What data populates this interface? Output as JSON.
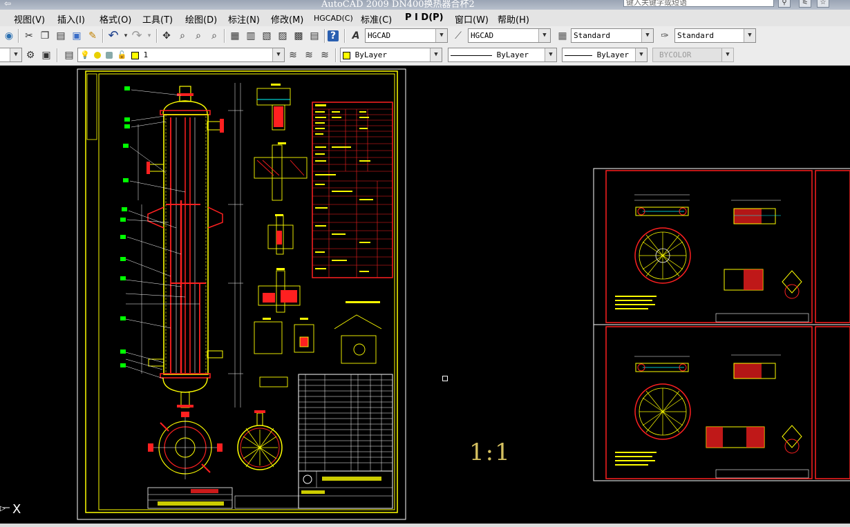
{
  "window": {
    "title": "AutoCAD 2009  DN400换热器合杯2",
    "search_placeholder": "键入关键字或短语"
  },
  "menu": {
    "items": [
      "视图(V)",
      "插入(I)",
      "格式(O)",
      "工具(T)",
      "绘图(D)",
      "标注(N)",
      "修改(M)",
      "HGCAD(C)",
      "标准(C)",
      "P I D(P)",
      "窗口(W)",
      "帮助(H)"
    ]
  },
  "toolbar1": {
    "text_style": "HGCAD",
    "dim_style": "HGCAD",
    "table_style": "Standard",
    "multileader_style": "Standard"
  },
  "toolbar2": {
    "layer_name": "1",
    "color": "ByLayer",
    "linetype": "ByLayer",
    "lineweight": "ByLayer",
    "plot_style": "BYCOLOR"
  },
  "canvas": {
    "scale_label": "1:1",
    "ucs_axis_label": "X",
    "colors": {
      "background": "#000000",
      "frame": "#ffff00",
      "red": "#ff2020",
      "cyan": "#00ffff",
      "white": "#ffffff",
      "green": "#00ff00"
    }
  },
  "icons": [
    "back-arrow-icon",
    "search-icon",
    "star-icon",
    "cut-icon",
    "copy-icon",
    "paste-icon",
    "undo-icon",
    "redo-icon",
    "pan-icon",
    "zoom-icon",
    "help-icon",
    "layer-icon",
    "lightbulb-icon",
    "sun-icon",
    "lock-icon"
  ]
}
